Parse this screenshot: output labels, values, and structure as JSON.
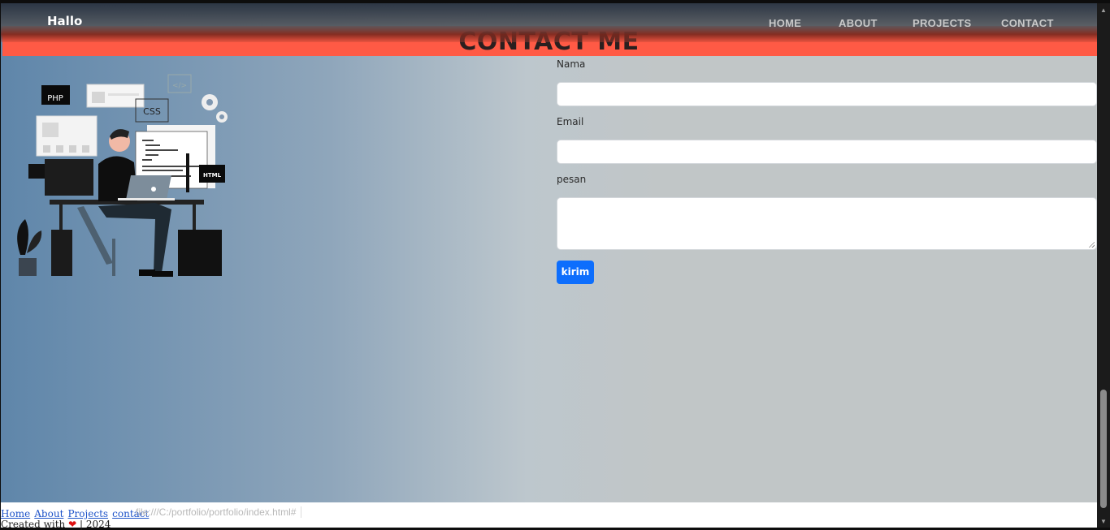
{
  "navbar": {
    "brand": "Hallo",
    "links": [
      "HOME",
      "ABOUT",
      "PROJECTS",
      "CONTACT"
    ]
  },
  "section": {
    "title": "CONTACT ME"
  },
  "illustration": {
    "tags": [
      "PHP",
      "CSS",
      "HTML"
    ],
    "code_glyph": "</>"
  },
  "form": {
    "name_label": "Nama",
    "email_label": "Email",
    "message_label": "pesan",
    "submit_label": "kirim"
  },
  "footer": {
    "links": [
      "Home",
      "About",
      "Projects",
      "contact"
    ],
    "credit_prefix": "Created with",
    "heart": "❤",
    "credit_suffix": "| 2024",
    "status_url": "file:///C:/portfolio/portfolio/index.html#"
  }
}
